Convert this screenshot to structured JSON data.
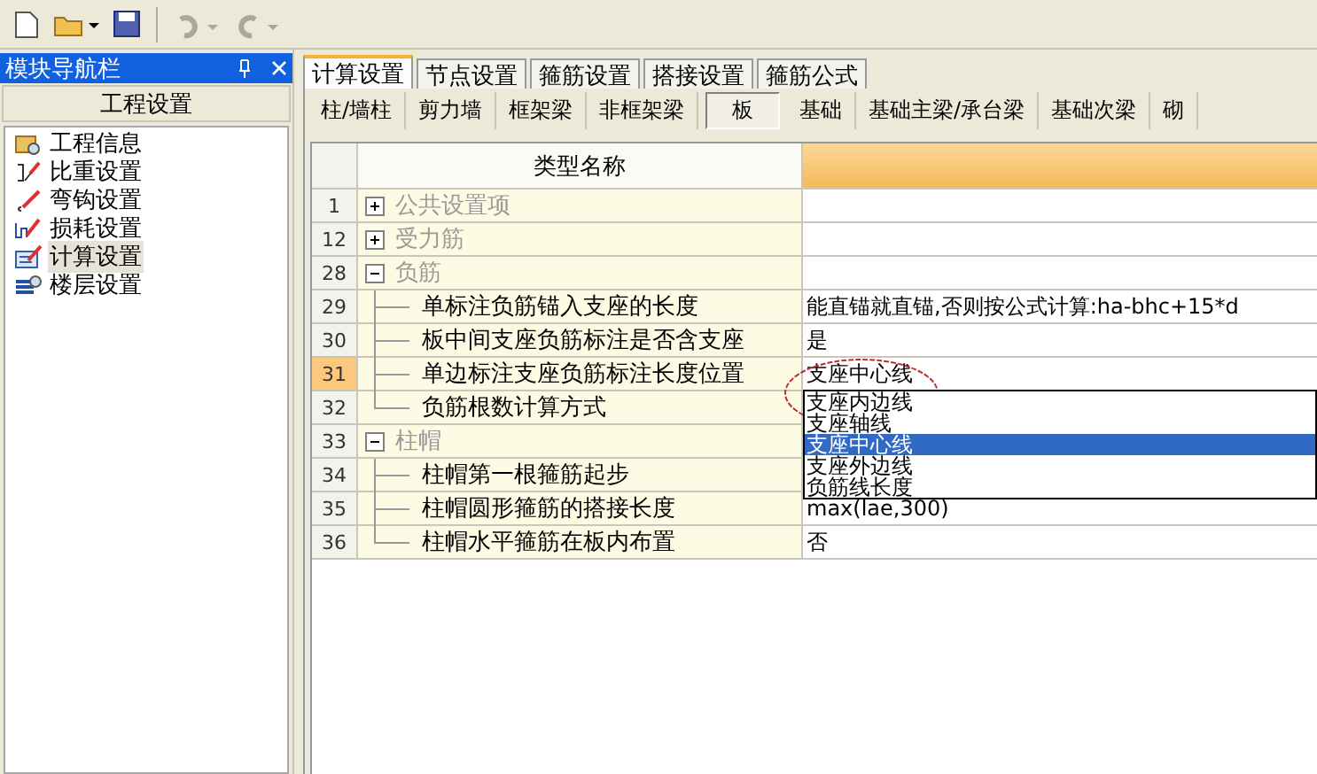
{
  "toolbar": {
    "redo_disabled": true,
    "undo_disabled": true
  },
  "nav_panel": {
    "title": "模块导航栏",
    "section_button": "工程设置",
    "items": [
      {
        "label": "工程信息",
        "selected": false
      },
      {
        "label": "比重设置",
        "selected": false
      },
      {
        "label": "弯钩设置",
        "selected": false
      },
      {
        "label": "损耗设置",
        "selected": false
      },
      {
        "label": "计算设置",
        "selected": true
      },
      {
        "label": "楼层设置",
        "selected": false
      }
    ]
  },
  "tabs": [
    {
      "label": "计算设置",
      "selected": true
    },
    {
      "label": "节点设置",
      "selected": false
    },
    {
      "label": "箍筋设置",
      "selected": false
    },
    {
      "label": "搭接设置",
      "selected": false
    },
    {
      "label": "箍筋公式",
      "selected": false
    }
  ],
  "sub_tabs": [
    {
      "label": "柱/墙柱",
      "selected": false
    },
    {
      "label": "剪力墙",
      "selected": false
    },
    {
      "label": "框架梁",
      "selected": false
    },
    {
      "label": "非框架梁",
      "selected": false
    },
    {
      "label": "板",
      "selected": true
    },
    {
      "label": "基础",
      "selected": false
    },
    {
      "label": "基础主梁/承台梁",
      "selected": false
    },
    {
      "label": "基础次梁",
      "selected": false
    },
    {
      "label": "砌",
      "selected": false
    }
  ],
  "table": {
    "columns": [
      "类型名称"
    ],
    "rows": [
      {
        "number": "1",
        "label": "公共设置项",
        "expanded": false,
        "selected": false
      },
      {
        "number": "12",
        "label": "受力筋",
        "expanded": false,
        "selected": false
      },
      {
        "number": "28",
        "label": "负筋",
        "expanded": true,
        "selected": false,
        "children": [
          {
            "number": "29",
            "label": "单标注负筋锚入支座的长度",
            "value": "能直锚就直锚,否则按公式计算:ha-bhc+15*d",
            "selected": false
          },
          {
            "number": "30",
            "label": "板中间支座负筋标注是否含支座",
            "value": "是",
            "selected": false
          },
          {
            "number": "31",
            "label": "单边标注支座负筋标注长度位置",
            "value": "支座中心线",
            "selected": true,
            "dropdown": [
              {
                "label": "支座内边线",
                "selected": false
              },
              {
                "label": "支座轴线",
                "selected": false
              },
              {
                "label": "支座中心线",
                "selected": true
              },
              {
                "label": "支座外边线",
                "selected": false
              },
              {
                "label": "负筋线长度",
                "selected": false
              }
            ]
          },
          {
            "number": "32",
            "label": "负筋根数计算方式",
            "selected": false
          }
        ]
      },
      {
        "number": "33",
        "label": "柱帽",
        "expanded": true,
        "selected": false,
        "children": [
          {
            "number": "34",
            "label": "柱帽第一根箍筋起步",
            "selected": false
          },
          {
            "number": "35",
            "label": "柱帽圆形箍筋的搭接长度",
            "value": "max(lae,300)",
            "selected": false
          },
          {
            "number": "36",
            "label": "柱帽水平箍筋在板内布置",
            "value": "否",
            "selected": false
          }
        ]
      }
    ]
  }
}
